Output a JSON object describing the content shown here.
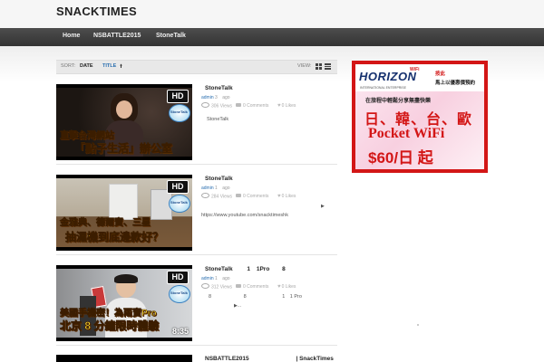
{
  "site": {
    "title": "SNACKTIMES"
  },
  "nav": {
    "items": [
      "Home",
      "NSBATTLE2015",
      "StoneTalk"
    ]
  },
  "sortbar": {
    "sort_label": "SORT:",
    "date": "DATE",
    "title": "TITLE",
    "view_label": "VIEW:"
  },
  "posts": [
    {
      "title": "StoneTalk",
      "author": "admin",
      "age": "3",
      "ago": "ago",
      "views": "306 Views",
      "comments": "0 Comments",
      "likes": "0 Likes",
      "excerpt": "StoneTalk",
      "thumb": {
        "badge": "HD",
        "caption1": "直擊台灣網站",
        "caption2": "「點子生活」辦公室",
        "duration": ""
      }
    },
    {
      "title": "StoneTalk",
      "author": "admin",
      "age": "1",
      "ago": "ago",
      "views": "284 Views",
      "comments": "0 Comments",
      "likes": "0 Likes",
      "play": "▶",
      "excerpt": "https://www.youtube.com/snacktimeshk",
      "thumb": {
        "badge": "HD",
        "caption1": "金雅典、德爾寶、三星",
        "caption2": "抽濕機到底邊款好？",
        "duration": ""
      }
    },
    {
      "title": "StoneTalk",
      "title_extra": [
        "1",
        "1Pro",
        "8"
      ],
      "author": "admin",
      "age": "1",
      "ago": "ago",
      "views": "312 Views",
      "comments": "0 Comments",
      "likes": "0 Likes",
      "excerpt_parts": [
        "8",
        "8",
        "1",
        "1 Pro"
      ],
      "more": "▶...",
      "thumb": {
        "badge": "HD",
        "caption1": "美國手機密！為兩寶Pro",
        "caption2": "北京 8 分鐘限時體驗",
        "duration": "8:35"
      }
    },
    {
      "title": "NSBATTLE2015",
      "title_extra": [
        "| SnackTimes"
      ]
    }
  ],
  "ad": {
    "logo": "HORIZON",
    "logo_wifi": "WiFi",
    "logo_sub": "INTERNATIONAL ENTERPRISE",
    "call1": "按此",
    "call2": "馬上以優惠價預約",
    "line1": "在旅程中輕鬆分享無盡快樂",
    "line2": "日、韓、台、歐",
    "line3": "Pocket WiFi",
    "line4": "$60/日 起"
  },
  "colors": {
    "nav_bg": "#3d3d3d",
    "accent_link": "#2a6fb0",
    "ad_red": "#d31616"
  }
}
